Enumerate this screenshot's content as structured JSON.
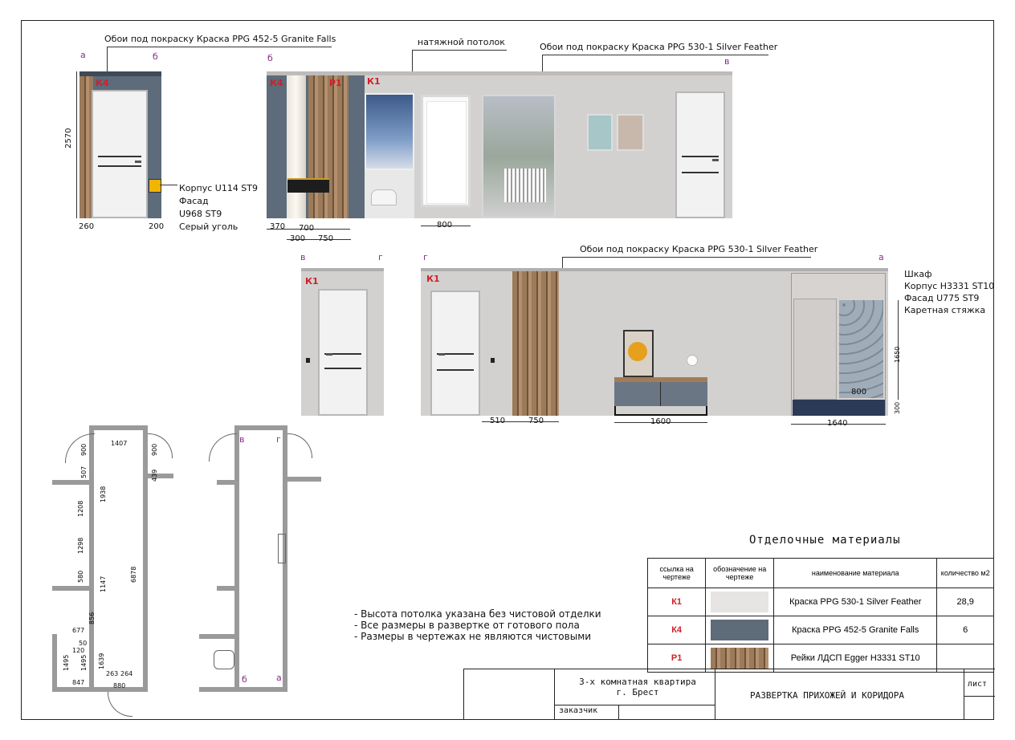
{
  "elev1": {
    "top_label": "Обои под покраску Краска  PPG 452-5 Granite Falls",
    "mark_a": "а",
    "mark_b": "б",
    "k4": "К4",
    "dim_h": "2570",
    "dim_left": "260",
    "dim_right": "200",
    "note_lines": [
      "Корпус U114 ST9",
      "Фасад",
      "U968 ST9",
      "Серый уголь"
    ]
  },
  "elev2": {
    "ceiling_label": "натяжной потолок",
    "right_label": "Обои под покраску Краска  PPG 530-1 Silver Feather",
    "mark_b": "б",
    "mark_v": "в",
    "k4": "К4",
    "p1": "Р1",
    "k1": "К1",
    "dims": [
      "370",
      "700",
      "300",
      "750",
      "800"
    ]
  },
  "elev3": {
    "mark_v": "в",
    "mark_g": "г",
    "k1": "К1"
  },
  "elev4": {
    "top_label": "Обои под покраску Краска  PPG 530-1 Silver Feather",
    "mark_g": "г",
    "mark_a": "а",
    "k1": "К1",
    "note_lines": [
      "Шкаф",
      "Корпус H3331 ST10",
      "Фасад U775 ST9",
      "Каретная стяжка"
    ],
    "dims": [
      "1650",
      "300",
      "800",
      "510",
      "750",
      "1600",
      "1640"
    ]
  },
  "plan1": {
    "dims": [
      "1407",
      "900",
      "900",
      "507",
      "439",
      "1938",
      "1208",
      "6878",
      "1298",
      "580",
      "1147",
      "677",
      "856",
      "50",
      "120",
      "1495",
      "1495",
      "1639",
      "263",
      "264",
      "847",
      "880"
    ]
  },
  "plan2": {
    "mark_v": "в",
    "mark_g": "г",
    "mark_b": "б",
    "mark_a": "а"
  },
  "notes": [
    "- Высота потолка указана без чистовой отделки",
    "- Все размеры в развертке от готового пола",
    "- Размеры в чертежах не являются чистовыми"
  ],
  "materials": {
    "title": "Отделочные материалы",
    "headers": [
      "ссылка на чертеже",
      "обозначение на чертеже",
      "наименование материала",
      "количество м2"
    ],
    "rows": [
      {
        "ref": "К1",
        "name": "Краска PPG 530-1 Silver Feather",
        "qty": "28,9",
        "swatch": "#e6e5e4"
      },
      {
        "ref": "К4",
        "name": "Краска PPG 452-5 Granite Falls",
        "qty": "6",
        "swatch": "#5e6b78"
      },
      {
        "ref": "Р1",
        "name": "Рейки ЛДСП Egger H3331 ST10",
        "qty": "",
        "swatch": "wood"
      }
    ]
  },
  "stamp": {
    "project_line1": "3-х комнатная квартира",
    "project_line2": "г. Брест",
    "customer": "заказчик",
    "sheet_title": "РАЗВЕРТКА ПРИХОЖЕЙ И КОРИДОРА",
    "sheet_label": "лист"
  }
}
